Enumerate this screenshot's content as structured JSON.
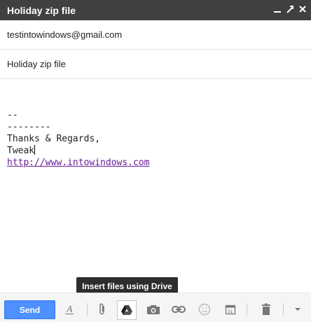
{
  "window": {
    "title": "Holiday zip file"
  },
  "compose": {
    "to": "testintowindows@gmail.com",
    "subject": "Holiday zip file",
    "body_lines": [
      "--",
      "--------",
      "Thanks & Regards,",
      "Tweak"
    ],
    "link": "http://www.intowindows.com"
  },
  "toolbar": {
    "send_label": "Send",
    "tooltip": "Insert files using Drive"
  },
  "colors": {
    "titlebar": "#404040",
    "send_button": "#4d90fe",
    "link": "#6a1b9a"
  },
  "icons": [
    "minimize-icon",
    "popout-icon",
    "close-icon",
    "text-format-icon",
    "attach-icon",
    "drive-icon",
    "camera-icon",
    "link-icon",
    "emoji-icon",
    "calendar-icon",
    "trash-icon",
    "chevron-down-icon"
  ]
}
